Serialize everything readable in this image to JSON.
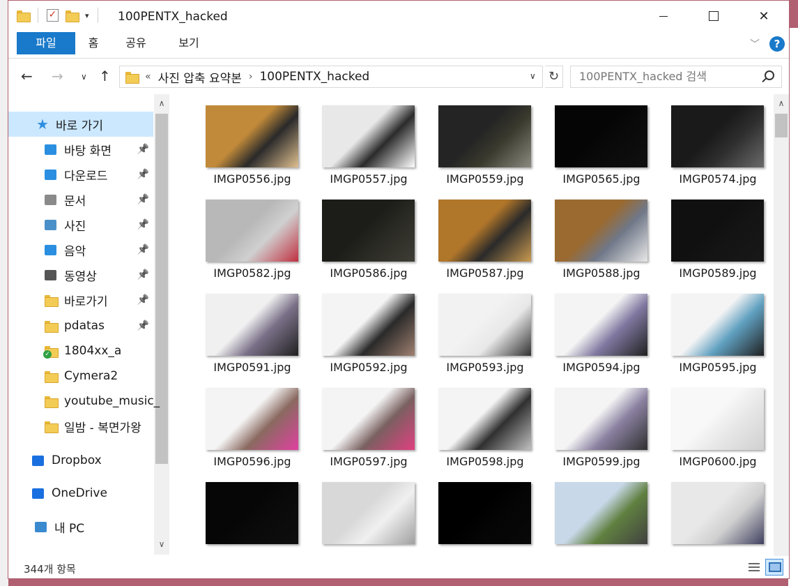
{
  "window": {
    "title": "100PENTX_hacked",
    "controls": {
      "minimize": "",
      "maximize": "",
      "close": "✕"
    }
  },
  "ribbon": {
    "tabs": [
      "파일",
      "홈",
      "공유",
      "보기"
    ]
  },
  "navigation": {
    "breadcrumb_overflow": "«",
    "breadcrumb": [
      "사진 압축 요약본",
      "100PENTX_hacked"
    ],
    "search_placeholder": "100PENTX_hacked 검색"
  },
  "sidebar": {
    "items": [
      {
        "label": "바로 가기",
        "icon": "star-icon",
        "pinned": false
      },
      {
        "label": "바탕 화면",
        "icon": "desktop-icon",
        "pinned": true
      },
      {
        "label": "다운로드",
        "icon": "download-icon",
        "pinned": true
      },
      {
        "label": "문서",
        "icon": "document-icon",
        "pinned": true
      },
      {
        "label": "사진",
        "icon": "pictures-icon",
        "pinned": true
      },
      {
        "label": "음악",
        "icon": "music-icon",
        "pinned": true
      },
      {
        "label": "동영상",
        "icon": "video-icon",
        "pinned": true
      },
      {
        "label": "바로가기",
        "icon": "folder-icon",
        "pinned": true
      },
      {
        "label": "pdatas",
        "icon": "folder-icon",
        "pinned": true
      },
      {
        "label": "1804xx_a",
        "icon": "folder-synced-icon",
        "pinned": false
      },
      {
        "label": "Cymera2",
        "icon": "folder-icon",
        "pinned": false
      },
      {
        "label": "youtube_music_",
        "icon": "folder-icon",
        "pinned": false
      },
      {
        "label": "일밤 - 복면가왕",
        "icon": "folder-icon",
        "pinned": false
      },
      {
        "label": "Dropbox",
        "icon": "dropbox-icon",
        "pinned": false
      },
      {
        "label": "OneDrive",
        "icon": "onedrive-icon",
        "pinned": false
      },
      {
        "label": "내 PC",
        "icon": "pc-icon",
        "pinned": false
      }
    ]
  },
  "files": [
    {
      "name": "IMGP0556.jpg",
      "colors": [
        "#c08a3a",
        "#2a2a2a",
        "#e0c090"
      ]
    },
    {
      "name": "IMGP0557.jpg",
      "colors": [
        "#e8e8e8",
        "#2b2b2b",
        "#ffffff"
      ]
    },
    {
      "name": "IMGP0559.jpg",
      "colors": [
        "#242424",
        "#3a3a2e",
        "#8a8a80"
      ]
    },
    {
      "name": "IMGP0565.jpg",
      "colors": [
        "#050505",
        "#0a0a0a",
        "#101010"
      ]
    },
    {
      "name": "IMGP0574.jpg",
      "colors": [
        "#1a1a1a",
        "#2e2e2e",
        "#6a6a6a"
      ]
    },
    {
      "name": "IMGP0582.jpg",
      "colors": [
        "#b8b8b8",
        "#d0d0d0",
        "#c03040"
      ]
    },
    {
      "name": "IMGP0586.jpg",
      "colors": [
        "#1c1c18",
        "#2a2a24",
        "#3e3e36"
      ]
    },
    {
      "name": "IMGP0587.jpg",
      "colors": [
        "#b0762a",
        "#2a2a2a",
        "#c99a50"
      ]
    },
    {
      "name": "IMGP0588.jpg",
      "colors": [
        "#9a6a30",
        "#707888",
        "#e8e8e8"
      ]
    },
    {
      "name": "IMGP0589.jpg",
      "colors": [
        "#101010",
        "#141414",
        "#181818"
      ]
    },
    {
      "name": "IMGP0591.jpg",
      "colors": [
        "#f0f0f0",
        "#7a7088",
        "#202020"
      ]
    },
    {
      "name": "IMGP0592.jpg",
      "colors": [
        "#f4f4f4",
        "#2a2a2a",
        "#a08070"
      ]
    },
    {
      "name": "IMGP0593.jpg",
      "colors": [
        "#f2f2f2",
        "#e8e8e8",
        "#303030"
      ]
    },
    {
      "name": "IMGP0594.jpg",
      "colors": [
        "#f4f4f4",
        "#8078a0",
        "#202020"
      ]
    },
    {
      "name": "IMGP0595.jpg",
      "colors": [
        "#f4f4f4",
        "#60a0c0",
        "#202020"
      ]
    },
    {
      "name": "IMGP0596.jpg",
      "colors": [
        "#f4f4f4",
        "#8a6a60",
        "#e040a0"
      ]
    },
    {
      "name": "IMGP0597.jpg",
      "colors": [
        "#f4f4f4",
        "#7a6060",
        "#e04080"
      ]
    },
    {
      "name": "IMGP0598.jpg",
      "colors": [
        "#f4f4f4",
        "#303030",
        "#c0c0c0"
      ]
    },
    {
      "name": "IMGP0599.jpg",
      "colors": [
        "#f4f4f4",
        "#8a80a0",
        "#303030"
      ]
    },
    {
      "name": "IMGP0600.jpg",
      "colors": [
        "#f8f8f8",
        "#e8e8e8",
        "#d0d0d0"
      ]
    },
    {
      "name": "",
      "colors": [
        "#060606",
        "#0a0a0a",
        "#0e0e0e"
      ]
    },
    {
      "name": "",
      "colors": [
        "#d8d8d8",
        "#f0f0f0",
        "#a0a0a0"
      ]
    },
    {
      "name": "",
      "colors": [
        "#000000",
        "#050505",
        "#080808"
      ]
    },
    {
      "name": "",
      "colors": [
        "#c8d8e8",
        "#608040",
        "#404040"
      ]
    },
    {
      "name": "",
      "colors": [
        "#e8e8e8",
        "#d0d0d0",
        "#404060"
      ]
    }
  ],
  "status": {
    "item_count": "344개 항목"
  },
  "accent_color": "#1979ca"
}
